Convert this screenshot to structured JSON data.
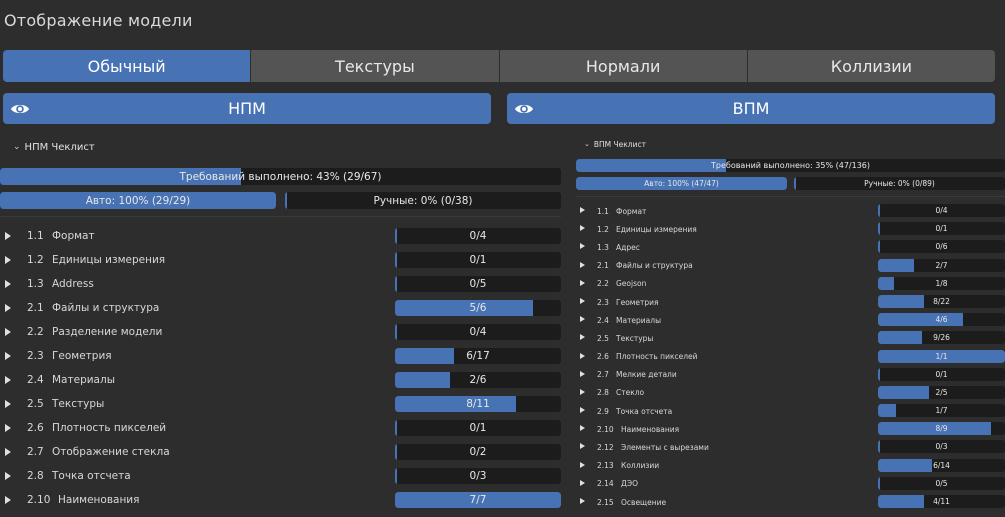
{
  "title": "Отображение модели",
  "tabs": [
    {
      "label": "Обычный",
      "active": true
    },
    {
      "label": "Текстуры",
      "active": false
    },
    {
      "label": "Нормали",
      "active": false
    },
    {
      "label": "Коллизии",
      "active": false
    }
  ],
  "toggles": {
    "npm": {
      "label": "НПМ",
      "icon": "eye-icon"
    },
    "vpm": {
      "label": "ВПМ",
      "icon": "eye-icon"
    }
  },
  "npm_checklist": {
    "header": "НПМ Чеклист",
    "total": {
      "label": "Требований выполнено: 43% (29/67)",
      "fraction": 0.43
    },
    "auto": {
      "label": "Авто: 100% (29/29)",
      "fraction": 1.0
    },
    "manual": {
      "label": "Ручные: 0% (0/38)",
      "fraction": 0.0
    },
    "items": [
      {
        "code": "1.1",
        "name": "Формат",
        "progress": "0/4",
        "fraction": 0.0
      },
      {
        "code": "1.2",
        "name": "Единицы измерения",
        "progress": "0/1",
        "fraction": 0.0
      },
      {
        "code": "1.3",
        "name": "Address",
        "progress": "0/5",
        "fraction": 0.0
      },
      {
        "code": "2.1",
        "name": "Файлы и структура",
        "progress": "5/6",
        "fraction": 0.8333
      },
      {
        "code": "2.2",
        "name": "Разделение модели",
        "progress": "0/4",
        "fraction": 0.0
      },
      {
        "code": "2.3",
        "name": "Геометрия",
        "progress": "6/17",
        "fraction": 0.353
      },
      {
        "code": "2.4",
        "name": "Материалы",
        "progress": "2/6",
        "fraction": 0.333
      },
      {
        "code": "2.5",
        "name": "Текстуры",
        "progress": "8/11",
        "fraction": 0.727
      },
      {
        "code": "2.6",
        "name": "Плотность пикселей",
        "progress": "0/1",
        "fraction": 0.0
      },
      {
        "code": "2.7",
        "name": "Отображение стекла",
        "progress": "0/2",
        "fraction": 0.0
      },
      {
        "code": "2.8",
        "name": "Точка отсчета",
        "progress": "0/3",
        "fraction": 0.0
      },
      {
        "code": "2.10",
        "name": "Наименования",
        "progress": "7/7",
        "fraction": 1.0
      }
    ]
  },
  "vpm_checklist": {
    "header": "ВПМ Чеклист",
    "total": {
      "label": "Требований выполнено: 35% (47/136)",
      "fraction": 0.35
    },
    "auto": {
      "label": "Авто: 100% (47/47)",
      "fraction": 1.0
    },
    "manual": {
      "label": "Ручные: 0% (0/89)",
      "fraction": 0.0
    },
    "items": [
      {
        "code": "1.1",
        "name": "Формат",
        "progress": "0/4",
        "fraction": 0.0
      },
      {
        "code": "1.2",
        "name": "Единицы измерения",
        "progress": "0/1",
        "fraction": 0.0
      },
      {
        "code": "1.3",
        "name": "Адрес",
        "progress": "0/6",
        "fraction": 0.0
      },
      {
        "code": "2.1",
        "name": "Файлы и структура",
        "progress": "2/7",
        "fraction": 0.2857
      },
      {
        "code": "2.2",
        "name": "Geojson",
        "progress": "1/8",
        "fraction": 0.125
      },
      {
        "code": "2.3",
        "name": "Геометрия",
        "progress": "8/22",
        "fraction": 0.3636
      },
      {
        "code": "2.4",
        "name": "Материалы",
        "progress": "4/6",
        "fraction": 0.6667
      },
      {
        "code": "2.5",
        "name": "Текстуры",
        "progress": "9/26",
        "fraction": 0.3462
      },
      {
        "code": "2.6",
        "name": "Плотность пикселей",
        "progress": "1/1",
        "fraction": 1.0
      },
      {
        "code": "2.7",
        "name": "Мелкие детали",
        "progress": "0/1",
        "fraction": 0.0
      },
      {
        "code": "2.8",
        "name": "Стекло",
        "progress": "2/5",
        "fraction": 0.4
      },
      {
        "code": "2.9",
        "name": "Точка отсчета",
        "progress": "1/7",
        "fraction": 0.1429
      },
      {
        "code": "2.10",
        "name": "Наименования",
        "progress": "8/9",
        "fraction": 0.8889
      },
      {
        "code": "2.12",
        "name": "Элементы с вырезами",
        "progress": "0/3",
        "fraction": 0.0
      },
      {
        "code": "2.13",
        "name": "Коллизии",
        "progress": "6/14",
        "fraction": 0.4286
      },
      {
        "code": "2.14",
        "name": "ДЭО",
        "progress": "0/5",
        "fraction": 0.0
      },
      {
        "code": "2.15",
        "name": "Освещение",
        "progress": "4/11",
        "fraction": 0.3636
      }
    ]
  },
  "colors": {
    "accent": "#4772b3",
    "background": "#2d2d2d",
    "bar_bg": "#1c1c1c",
    "tab_inactive": "#545454"
  }
}
